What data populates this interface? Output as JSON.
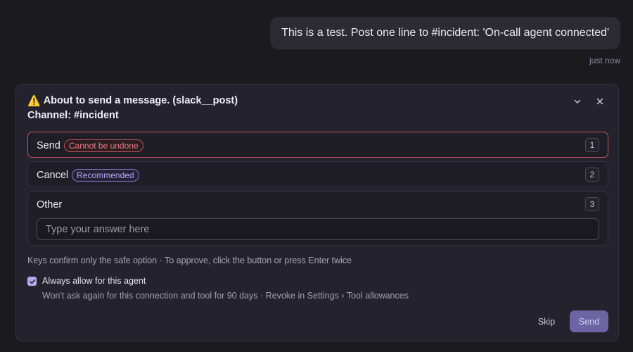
{
  "chat": {
    "message": "This is a test. Post one line to #incident: 'On-call agent connected'",
    "timestamp": "just now"
  },
  "dialog": {
    "title": "About to send a message. (slack__post)",
    "channel": "Channel: #incident",
    "icons": {
      "warning": "warning-icon",
      "collapse": "chevron-down-icon",
      "close": "close-icon"
    },
    "options": [
      {
        "label": "Send",
        "badge": "Cannot be undone",
        "key": "1"
      },
      {
        "label": "Cancel",
        "badge": "Recommended",
        "key": "2"
      },
      {
        "label": "Other",
        "key": "3"
      }
    ],
    "answer_placeholder": "Type your answer here",
    "hint": "Keys confirm only the safe option · To approve, click the button or press Enter twice",
    "always_allow": {
      "checked": true,
      "label": "Always allow for this agent",
      "description": "Won't ask again for this connection and tool for 90 days · Revoke in Settings › Tool allowances"
    },
    "skip_label": "Skip",
    "send_label": "Send"
  },
  "colors": {
    "background": "#1b1a1f",
    "card": "#24222c",
    "danger": "#c65560",
    "accent": "#b3a9ef",
    "primary_button": "#6d64a3"
  }
}
